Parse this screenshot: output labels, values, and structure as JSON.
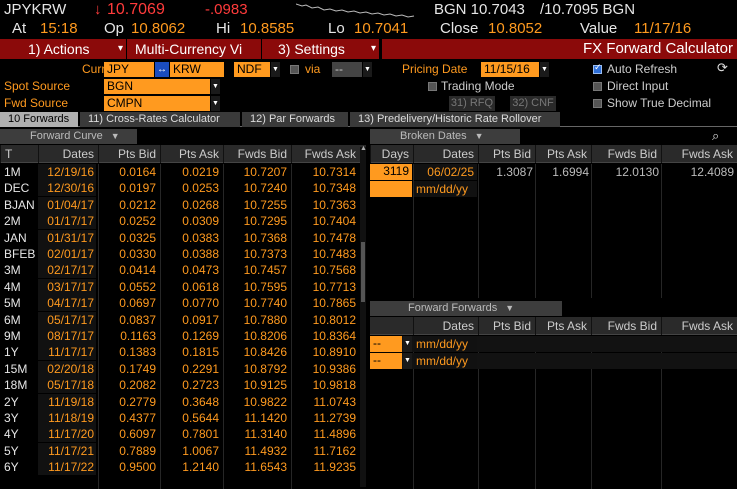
{
  "quote": {
    "ticker": "JPYKRW",
    "arrow": "↓",
    "last": "10.7069",
    "change": "-.0983",
    "sparkline": "sparkline-chart",
    "bgn_bid": "BGN 10.7043",
    "bgn_ask": "/10.7095 BGN",
    "at_label": "At",
    "time": "15:18",
    "op_label": "Op",
    "open": "10.8062",
    "hi_label": "Hi",
    "high": "10.8585",
    "lo_label": "Lo",
    "low": "10.7041",
    "close_label": "Close",
    "close": "10.8052",
    "value_label": "Value",
    "date": "11/17/16"
  },
  "menu": {
    "actions": "1) Actions",
    "multi_currency": "Multi-Currency Vi",
    "settings": "3) Settings",
    "title": "FX Forward Calculator"
  },
  "params": {
    "curr_label": "Curr",
    "ccy1": "JPY",
    "swap": "↔",
    "ccy2": "KRW",
    "ndf": "NDF",
    "via_label": "via",
    "via_value": "--",
    "spot_source_label": "Spot Source",
    "spot_source": "BGN",
    "fwd_source_label": "Fwd Source",
    "fwd_source": "CMPN",
    "pricing_date_label": "Pricing Date",
    "pricing_date": "11/15/16",
    "auto_refresh": "Auto Refresh",
    "trading_mode": "Trading Mode",
    "direct_input": "Direct Input",
    "rfq": "31) RFQ",
    "cnf": "32) CNF",
    "show_true_decimal": "Show True Decimal"
  },
  "tabs": [
    {
      "label": "10 Forwards"
    },
    {
      "label": "11) Cross-Rates Calculator"
    },
    {
      "label": "12) Par Forwards"
    },
    {
      "label": "13) Predelivery/Historic Rate Rollover"
    }
  ],
  "forward_curve": {
    "title": "Forward Curve",
    "headers": [
      "T",
      "Dates",
      "Pts Bid",
      "Pts Ask",
      "Fwds Bid",
      "Fwds Ask"
    ],
    "rows": [
      [
        "1M",
        "12/19/16",
        "0.0164",
        "0.0219",
        "10.7207",
        "10.7314"
      ],
      [
        "DEC",
        "12/30/16",
        "0.0197",
        "0.0253",
        "10.7240",
        "10.7348"
      ],
      [
        "BJAN",
        "01/04/17",
        "0.0212",
        "0.0268",
        "10.7255",
        "10.7363"
      ],
      [
        "2M",
        "01/17/17",
        "0.0252",
        "0.0309",
        "10.7295",
        "10.7404"
      ],
      [
        "JAN",
        "01/31/17",
        "0.0325",
        "0.0383",
        "10.7368",
        "10.7478"
      ],
      [
        "BFEB",
        "02/01/17",
        "0.0330",
        "0.0388",
        "10.7373",
        "10.7483"
      ],
      [
        "3M",
        "02/17/17",
        "0.0414",
        "0.0473",
        "10.7457",
        "10.7568"
      ],
      [
        "4M",
        "03/17/17",
        "0.0552",
        "0.0618",
        "10.7595",
        "10.7713"
      ],
      [
        "5M",
        "04/17/17",
        "0.0697",
        "0.0770",
        "10.7740",
        "10.7865"
      ],
      [
        "6M",
        "05/17/17",
        "0.0837",
        "0.0917",
        "10.7880",
        "10.8012"
      ],
      [
        "9M",
        "08/17/17",
        "0.1163",
        "0.1269",
        "10.8206",
        "10.8364"
      ],
      [
        "1Y",
        "11/17/17",
        "0.1383",
        "0.1815",
        "10.8426",
        "10.8910"
      ],
      [
        "15M",
        "02/20/18",
        "0.1749",
        "0.2291",
        "10.8792",
        "10.9386"
      ],
      [
        "18M",
        "05/17/18",
        "0.2082",
        "0.2723",
        "10.9125",
        "10.9818"
      ],
      [
        "2Y",
        "11/19/18",
        "0.2779",
        "0.3648",
        "10.9822",
        "11.0743"
      ],
      [
        "3Y",
        "11/18/19",
        "0.4377",
        "0.5644",
        "11.1420",
        "11.2739"
      ],
      [
        "4Y",
        "11/17/20",
        "0.6097",
        "0.7801",
        "11.3140",
        "11.4896"
      ],
      [
        "5Y",
        "11/17/21",
        "0.7889",
        "1.0067",
        "11.4932",
        "11.7162"
      ],
      [
        "6Y",
        "11/17/22",
        "0.9500",
        "1.2140",
        "11.6543",
        "11.9235"
      ]
    ]
  },
  "broken_dates": {
    "title": "Broken Dates",
    "headers": [
      "Days",
      "Dates",
      "Pts Bid",
      "Pts Ask",
      "Fwds Bid",
      "Fwds Ask"
    ],
    "row": {
      "days": "3119",
      "date": "06/02/25",
      "pts_bid": "1.3087",
      "pts_ask": "1.6994",
      "fwds_bid": "12.0130",
      "fwds_ask": "12.4089"
    },
    "placeholder_date": "mm/dd/yy"
  },
  "forward_forwards": {
    "title": "Forward Forwards",
    "headers": [
      "Dates",
      "Pts Bid",
      "Pts Ask",
      "Fwds Bid",
      "Fwds Ask"
    ],
    "rows": [
      {
        "sel": "--",
        "date": "mm/dd/yy"
      },
      {
        "sel": "--",
        "date": "mm/dd/yy"
      }
    ]
  },
  "colors": {
    "accent": "#ff9a1f",
    "menu_red": "#8b0a0a",
    "price_red": "#ff3b3b",
    "check_blue": "#2e6fd8"
  }
}
